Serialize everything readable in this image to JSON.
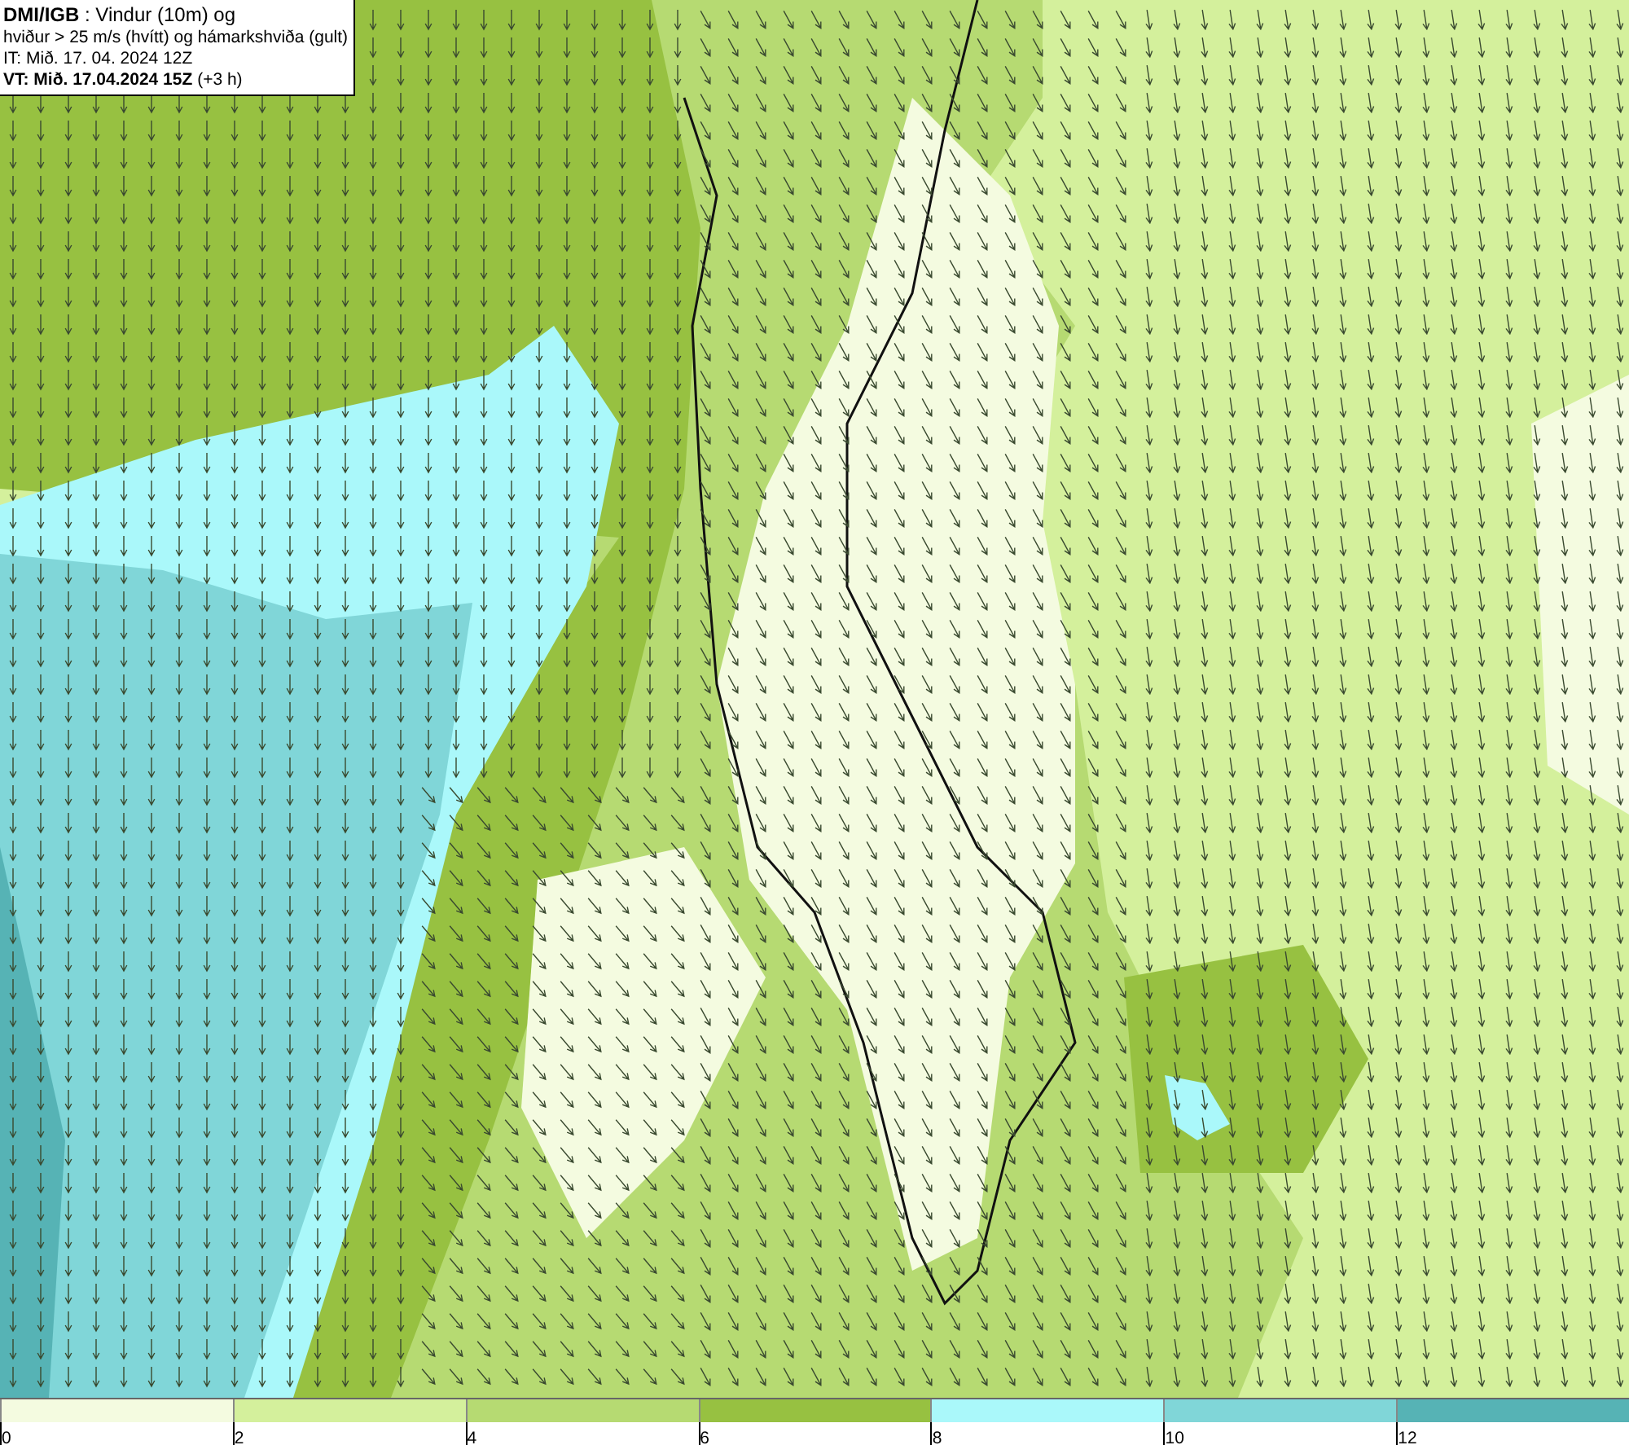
{
  "title_box": {
    "lines": [
      "**DMI/IGB** : Vindur (10m) og",
      "hviður > 25 m/s (hvítt) og hámarkshviða (gult)",
      "IT: Mið. 17. 04. 2024 12Z",
      "**VT: Mið. 17.04.2024 15Z** (+3 h)"
    ]
  },
  "legend": {
    "bins": [
      {
        "color": "#f4fbe0"
      },
      {
        "color": "#d4f09c"
      },
      {
        "color": "#b6da72"
      },
      {
        "color": "#97c141"
      },
      {
        "color": "#aaf8fa"
      },
      {
        "color": "#80d6d8"
      },
      {
        "color": "#56b3b5"
      }
    ],
    "ticks": [
      "0",
      "2",
      "4",
      "6",
      "8",
      "10",
      "12"
    ]
  }
}
